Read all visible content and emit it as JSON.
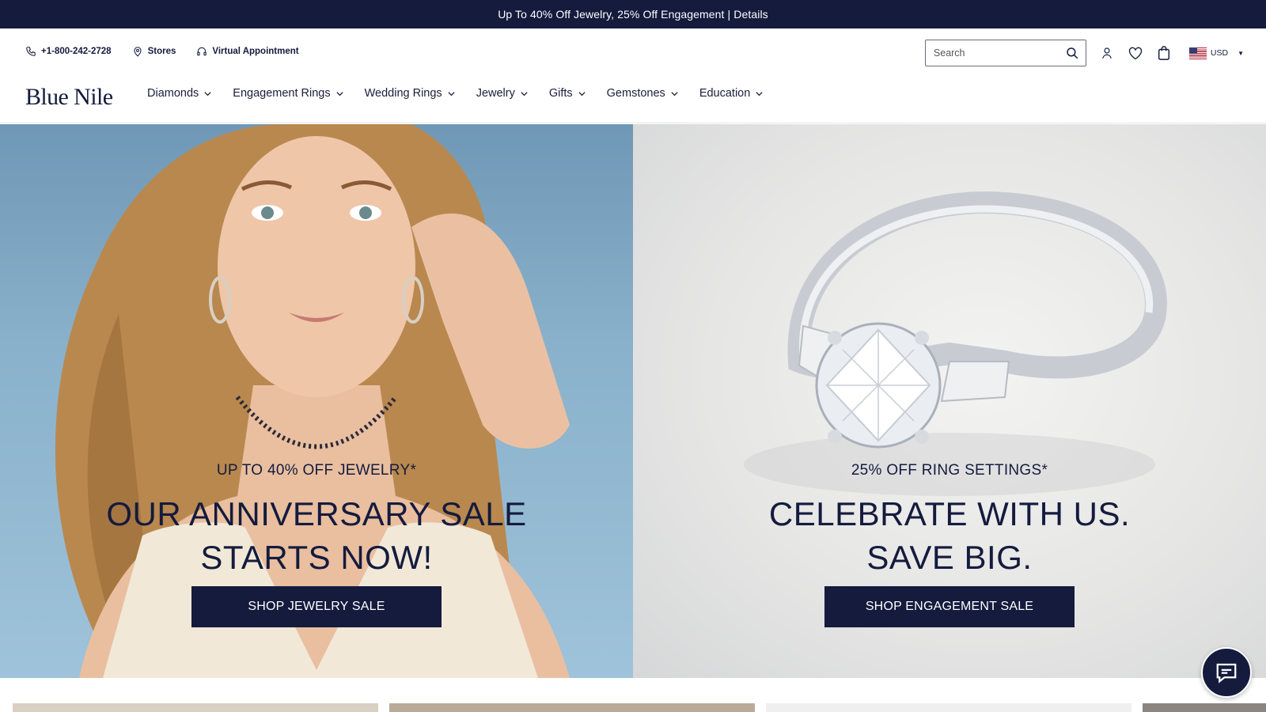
{
  "promo": {
    "text": "Up To 40% Off Jewelry, 25% Off Engagement | Details"
  },
  "utility": {
    "phone": "+1-800-242-2728",
    "stores": "Stores",
    "appointment": "Virtual Appointment",
    "search_placeholder": "Search",
    "currency": "USD"
  },
  "brand": {
    "logo": "Blue Nile"
  },
  "nav": {
    "items": [
      {
        "label": "Diamonds"
      },
      {
        "label": "Engagement Rings"
      },
      {
        "label": "Wedding Rings"
      },
      {
        "label": "Jewelry"
      },
      {
        "label": "Gifts"
      },
      {
        "label": "Gemstones"
      },
      {
        "label": "Education"
      }
    ]
  },
  "hero": {
    "left": {
      "eyebrow": "UP TO 40% OFF JEWELRY*",
      "headline_line1": "OUR ANNIVERSARY SALE",
      "headline_line2": "STARTS NOW!",
      "cta": "SHOP JEWELRY SALE"
    },
    "right": {
      "eyebrow": "25% OFF RING SETTINGS*",
      "headline_line1": "CELEBRATE WITH US.",
      "headline_line2": "SAVE BIG.",
      "cta": "SHOP ENGAGEMENT SALE"
    }
  },
  "colors": {
    "navy": "#141b3d",
    "promo_bg": "#141b3d",
    "left_panel_bg": "#8ab1cb",
    "right_panel_bg": "#e6e6e5"
  },
  "icons": {
    "phone": "phone-icon",
    "stores": "map-pin-icon",
    "appointment": "headset-icon",
    "search": "search-icon",
    "account": "user-icon",
    "wishlist": "heart-icon",
    "cart": "shopping-bag-icon",
    "chat": "chat-icon"
  }
}
